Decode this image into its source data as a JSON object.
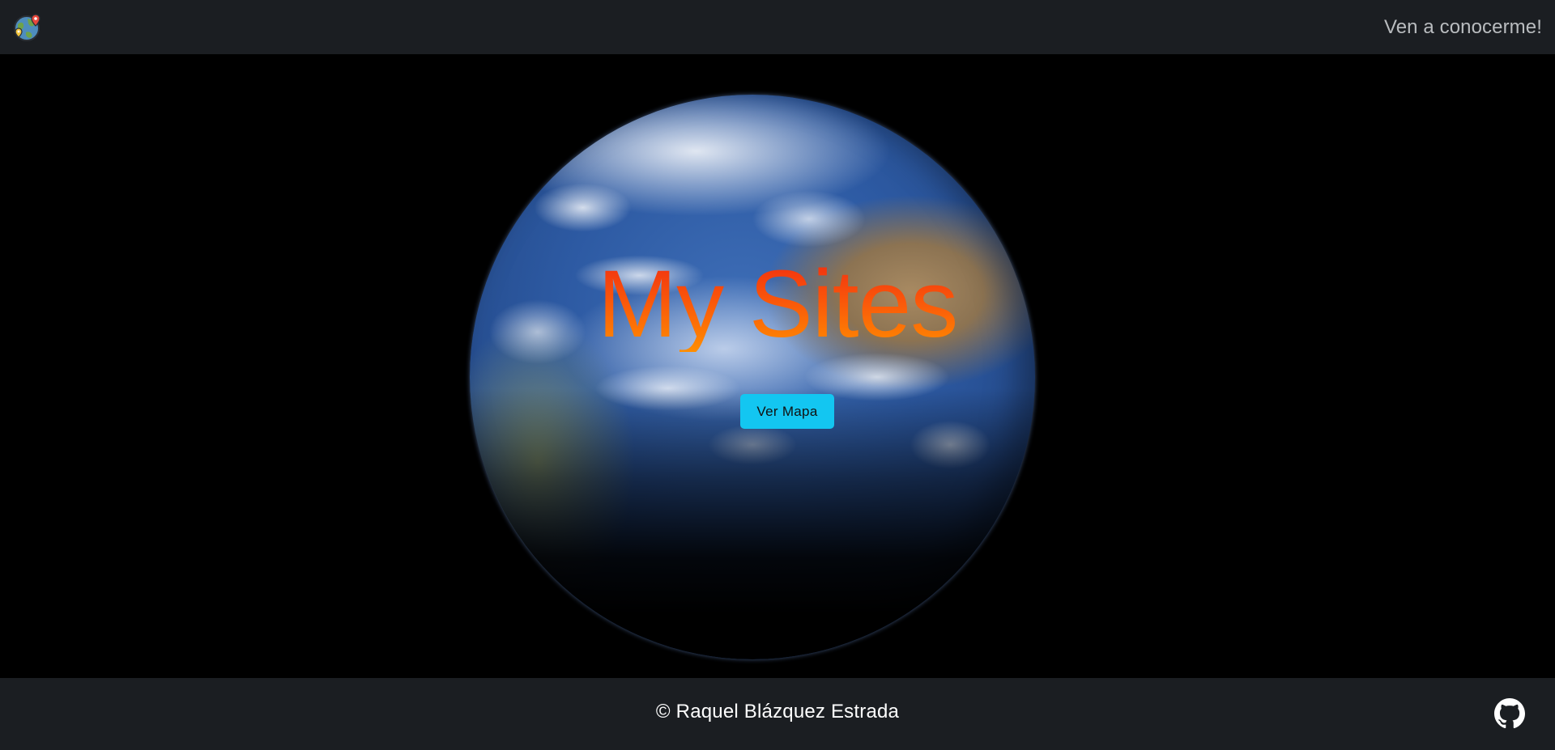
{
  "navbar": {
    "logo_icon": "globe-map-pin-icon",
    "link_label": "Ven a conocerme!"
  },
  "hero": {
    "background_icon": "earth-globe-image",
    "title": "My Sites",
    "button_label": "Ver Mapa",
    "title_colors": [
      "#f02c10",
      "#ff8e00"
    ],
    "button_color": "#13c6f1"
  },
  "footer": {
    "copyright": "© Raquel Blázquez Estrada",
    "github_icon": "github-icon"
  },
  "colors": {
    "bar_background": "#1b1e22",
    "page_background": "#000000"
  }
}
